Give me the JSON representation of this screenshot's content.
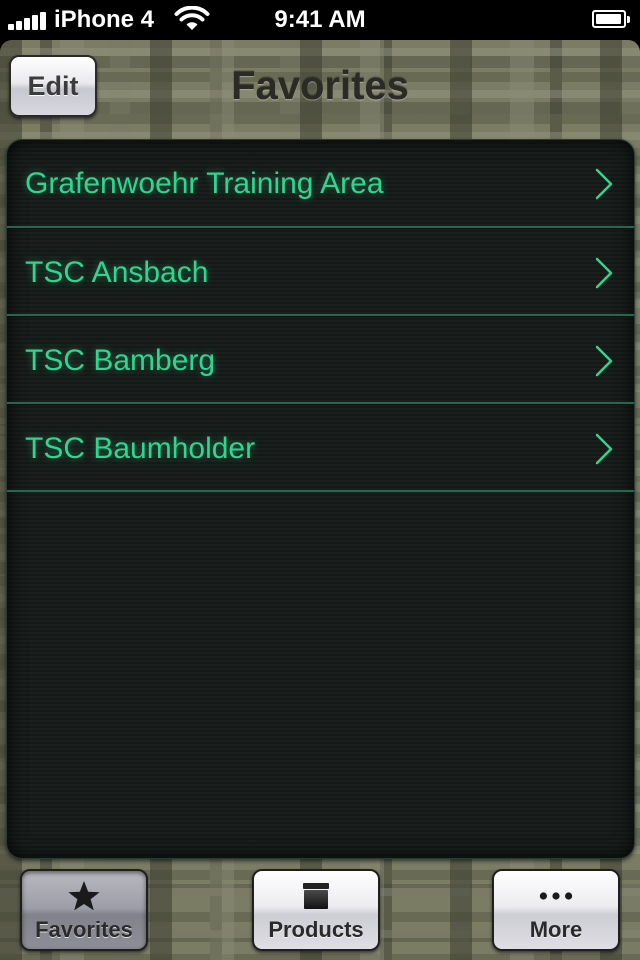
{
  "status_bar": {
    "carrier": "iPhone 4",
    "time": "9:41 AM",
    "signal_bars": 5,
    "battery_level": 0.95
  },
  "nav_bar": {
    "edit_label": "Edit",
    "title": "Favorites"
  },
  "list": {
    "items": [
      {
        "label": "Grafenwoehr Training Area",
        "icon": "chevron-right-icon"
      },
      {
        "label": "TSC Ansbach",
        "icon": "chevron-right-icon"
      },
      {
        "label": "TSC Bamberg",
        "icon": "chevron-right-icon"
      },
      {
        "label": "TSC Baumholder",
        "icon": "chevron-right-icon"
      }
    ]
  },
  "tab_bar": {
    "selected": "Favorites",
    "tabs": [
      {
        "label": "Favorites",
        "icon": "star-icon"
      },
      {
        "label": "Products",
        "icon": "box-icon"
      },
      {
        "label": "More",
        "icon": "more-dots-icon"
      }
    ]
  },
  "colors": {
    "list_text": "#2fd690",
    "row_separator": "#1e6b4d",
    "panel_background": "#141917",
    "camo_base": "#7a7c64"
  }
}
